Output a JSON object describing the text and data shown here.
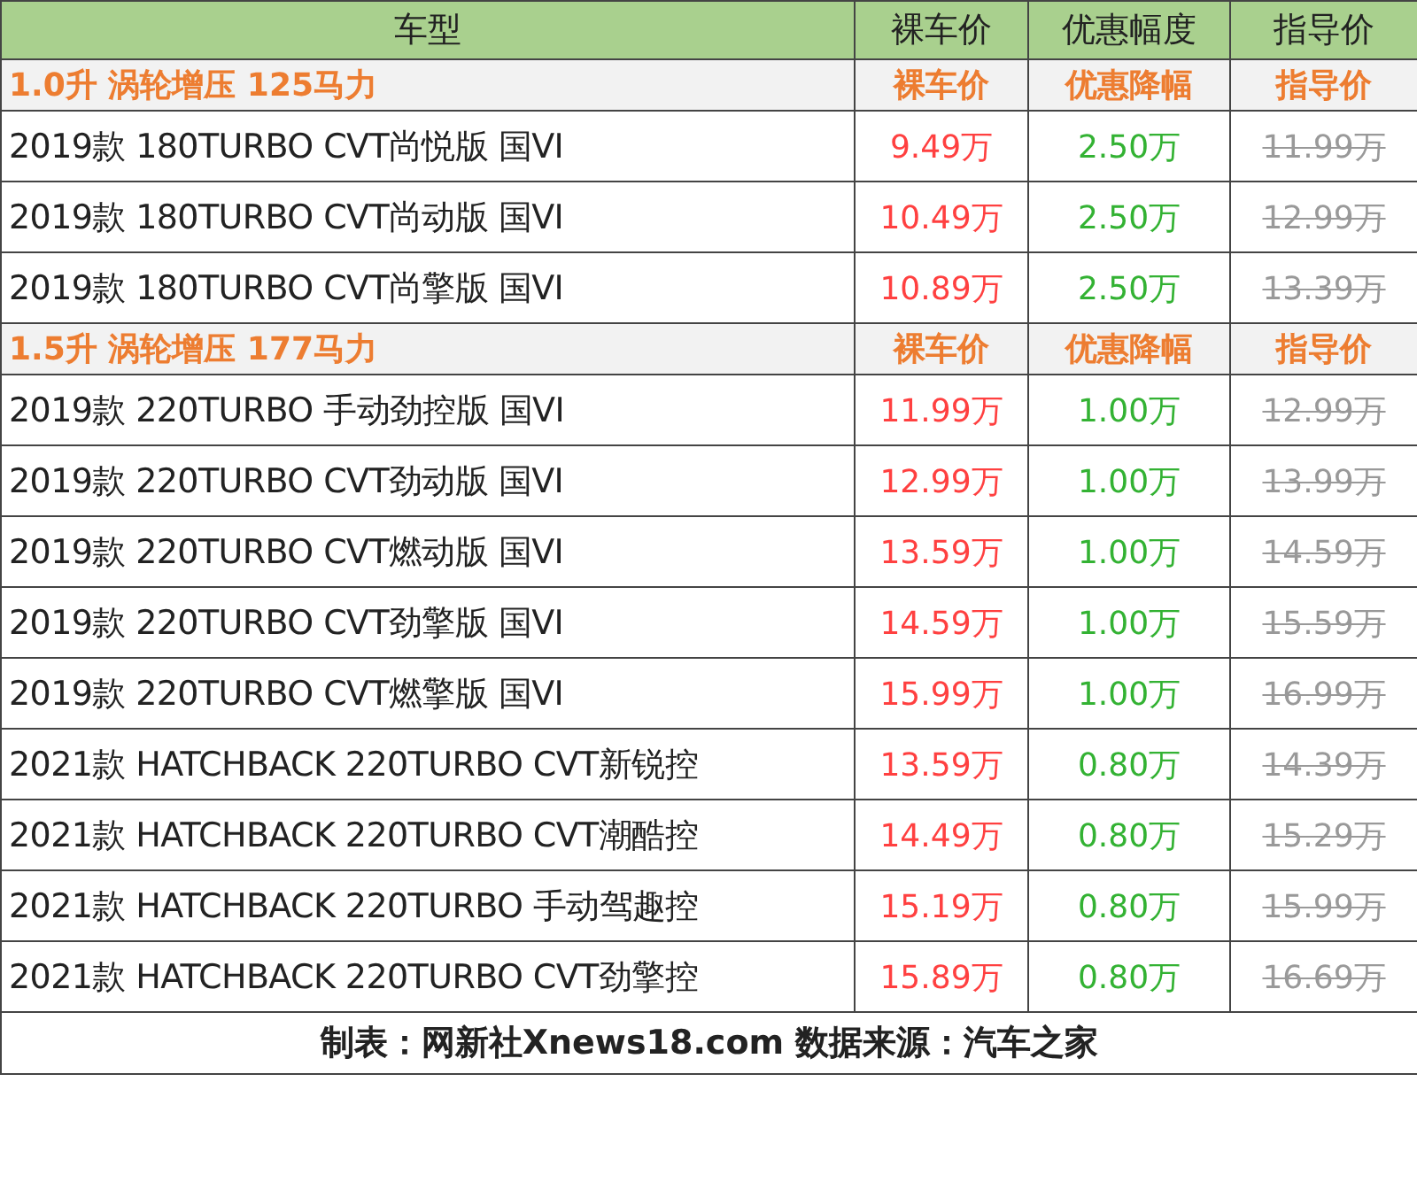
{
  "columns": [
    "车型",
    "裸车价",
    "优惠幅度",
    "指导价"
  ],
  "rows": [
    {
      "kind": "group",
      "cells": [
        "1.0升 涡轮增压 125马力",
        "裸车价",
        "优惠降幅",
        "指导价"
      ]
    },
    {
      "kind": "car",
      "cells": [
        "2019款 180TURBO CVT尚悦版 国VI",
        "9.49万",
        "2.50万",
        "11.99万"
      ]
    },
    {
      "kind": "car",
      "cells": [
        "2019款 180TURBO CVT尚动版 国VI",
        "10.49万",
        "2.50万",
        "12.99万"
      ]
    },
    {
      "kind": "car",
      "cells": [
        "2019款 180TURBO CVT尚擎版 国VI",
        "10.89万",
        "2.50万",
        "13.39万"
      ]
    },
    {
      "kind": "group",
      "cells": [
        "1.5升 涡轮增压 177马力",
        "裸车价",
        "优惠降幅",
        "指导价"
      ]
    },
    {
      "kind": "car",
      "cells": [
        "2019款 220TURBO 手动劲控版 国VI",
        "11.99万",
        "1.00万",
        "12.99万"
      ]
    },
    {
      "kind": "car",
      "cells": [
        "2019款 220TURBO CVT劲动版 国VI",
        "12.99万",
        "1.00万",
        "13.99万"
      ]
    },
    {
      "kind": "car",
      "cells": [
        "2019款 220TURBO CVT燃动版 国VI",
        "13.59万",
        "1.00万",
        "14.59万"
      ]
    },
    {
      "kind": "car",
      "cells": [
        "2019款 220TURBO CVT劲擎版 国VI",
        "14.59万",
        "1.00万",
        "15.59万"
      ]
    },
    {
      "kind": "car",
      "cells": [
        "2019款 220TURBO CVT燃擎版 国VI",
        "15.99万",
        "1.00万",
        "16.99万"
      ]
    },
    {
      "kind": "car",
      "cells": [
        "2021款 HATCHBACK 220TURBO CVT新锐控",
        "13.59万",
        "0.80万",
        "14.39万"
      ]
    },
    {
      "kind": "car",
      "cells": [
        "2021款 HATCHBACK 220TURBO CVT潮酷控",
        "14.49万",
        "0.80万",
        "15.29万"
      ]
    },
    {
      "kind": "car",
      "cells": [
        "2021款 HATCHBACK 220TURBO 手动驾趣控",
        "15.19万",
        "0.80万",
        "15.99万"
      ]
    },
    {
      "kind": "car",
      "cells": [
        "2021款 HATCHBACK 220TURBO CVT劲擎控",
        "15.89万",
        "0.80万",
        "16.69万"
      ]
    }
  ],
  "footer": "制表：网新社Xnews18.com 数据来源：汽车之家"
}
